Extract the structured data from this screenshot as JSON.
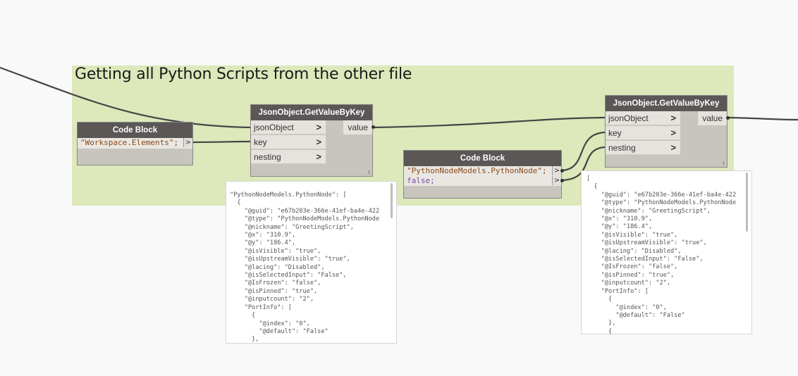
{
  "group": {
    "title": "Getting all Python Scripts from the other file"
  },
  "code_block_1": {
    "header": "Code Block",
    "line1": "\"Workspace.Elements\";",
    "out": ">"
  },
  "getvalue_1": {
    "header": "JsonObject.GetValueByKey",
    "inputs": [
      "jsonObject",
      "key",
      "nesting"
    ],
    "output": "value",
    "chev": ">"
  },
  "code_block_2": {
    "header": "Code Block",
    "line1": "\"PythonNodeModels.PythonNode\";",
    "line2": "false;",
    "out": ">"
  },
  "getvalue_2": {
    "header": "JsonObject.GetValueByKey",
    "inputs": [
      "jsonObject",
      "key",
      "nesting"
    ],
    "output": "value",
    "chev": ">"
  },
  "preview_1": {
    "text": "\"PythonNodeModels.PythonNode\": [\n  {\n    \"@guid\": \"e67b203e-366e-41ef-ba4e-422\n    \"@type\": \"PythonNodeModels.PythonNode\n    \"@nickname\": \"GreetingScript\",\n    \"@x\": \"310.9\",\n    \"@y\": \"186.4\",\n    \"@isVisible\": \"true\",\n    \"@isUpstreamVisible\": \"true\",\n    \"@lacing\": \"Disabled\",\n    \"@isSelectedInput\": \"False\",\n    \"@IsFrozen\": \"false\",\n    \"@isPinned\": \"true\",\n    \"@inputcount\": \"2\",\n    \"PortInfo\": [\n      {\n        \"@index\": \"0\",\n        \"@default\": \"False\"\n      },"
  },
  "preview_2": {
    "text": "[\n  {\n    \"@guid\": \"e67b203e-366e-41ef-ba4e-422\n    \"@type\": \"PythonNodeModels.PythonNode\n    \"@nickname\": \"GreetingScript\",\n    \"@x\": \"310.9\",\n    \"@y\": \"186.4\",\n    \"@isVisible\": \"true\",\n    \"@isUpstreamVisible\": \"true\",\n    \"@lacing\": \"Disabled\",\n    \"@isSelectedInput\": \"False\",\n    \"@IsFrozen\": \"false\",\n    \"@isPinned\": \"true\",\n    \"@inputcount\": \"2\",\n    \"PortInfo\": [\n      {\n        \"@index\": \"0\",\n        \"@default\": \"False\"\n      },\n      {"
  }
}
